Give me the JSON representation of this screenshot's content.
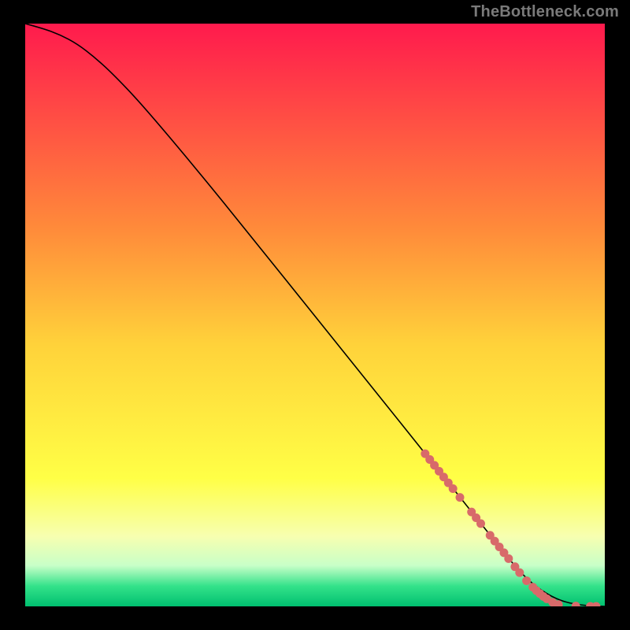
{
  "attribution": "TheBottleneck.com",
  "chart_data": {
    "type": "line",
    "title": "",
    "xlabel": "",
    "ylabel": "",
    "xlim": [
      0,
      100
    ],
    "ylim": [
      0,
      100
    ],
    "grid": false,
    "legend": false,
    "background_gradient": {
      "orientation": "vertical",
      "stops": [
        {
          "pos": 0.0,
          "color": "#ff1a4d"
        },
        {
          "pos": 0.35,
          "color": "#ff8a3a"
        },
        {
          "pos": 0.55,
          "color": "#ffd23a"
        },
        {
          "pos": 0.78,
          "color": "#ffff46"
        },
        {
          "pos": 0.88,
          "color": "#f7ffb0"
        },
        {
          "pos": 0.93,
          "color": "#c8ffc8"
        },
        {
          "pos": 0.965,
          "color": "#34e28a"
        },
        {
          "pos": 1.0,
          "color": "#00c070"
        }
      ]
    },
    "series": [
      {
        "name": "curve",
        "color": "#000000",
        "stroke_width": 1.6,
        "x": [
          0,
          3,
          6,
          9,
          12,
          15,
          20,
          30,
          40,
          50,
          60,
          70,
          78,
          82,
          85,
          88,
          92,
          96,
          100
        ],
        "y": [
          100,
          99.2,
          98.1,
          96.5,
          94.2,
          91.5,
          86.3,
          74.5,
          62.2,
          49.8,
          37.4,
          25.0,
          15.0,
          10.0,
          6.3,
          3.4,
          1.0,
          0.15,
          0.0
        ]
      }
    ],
    "markers": {
      "color": "#d86a6a",
      "radius": 5.5,
      "points": [
        {
          "x": 69.0,
          "y": 26.2
        },
        {
          "x": 69.8,
          "y": 25.2
        },
        {
          "x": 70.6,
          "y": 24.2
        },
        {
          "x": 71.4,
          "y": 23.2
        },
        {
          "x": 72.2,
          "y": 22.2
        },
        {
          "x": 73.0,
          "y": 21.2
        },
        {
          "x": 73.8,
          "y": 20.2
        },
        {
          "x": 75.0,
          "y": 18.7
        },
        {
          "x": 77.0,
          "y": 16.2
        },
        {
          "x": 77.8,
          "y": 15.2
        },
        {
          "x": 78.6,
          "y": 14.2
        },
        {
          "x": 80.2,
          "y": 12.2
        },
        {
          "x": 81.0,
          "y": 11.2
        },
        {
          "x": 81.8,
          "y": 10.2
        },
        {
          "x": 82.6,
          "y": 9.2
        },
        {
          "x": 83.4,
          "y": 8.2
        },
        {
          "x": 84.5,
          "y": 6.8
        },
        {
          "x": 85.3,
          "y": 5.8
        },
        {
          "x": 86.5,
          "y": 4.4
        },
        {
          "x": 87.6,
          "y": 3.3
        },
        {
          "x": 88.2,
          "y": 2.7
        },
        {
          "x": 88.8,
          "y": 2.2
        },
        {
          "x": 89.4,
          "y": 1.7
        },
        {
          "x": 90.0,
          "y": 1.3
        },
        {
          "x": 91.0,
          "y": 0.7
        },
        {
          "x": 92.0,
          "y": 0.3
        },
        {
          "x": 95.0,
          "y": 0.05
        },
        {
          "x": 97.5,
          "y": 0.0
        },
        {
          "x": 98.5,
          "y": 0.0
        }
      ]
    }
  }
}
